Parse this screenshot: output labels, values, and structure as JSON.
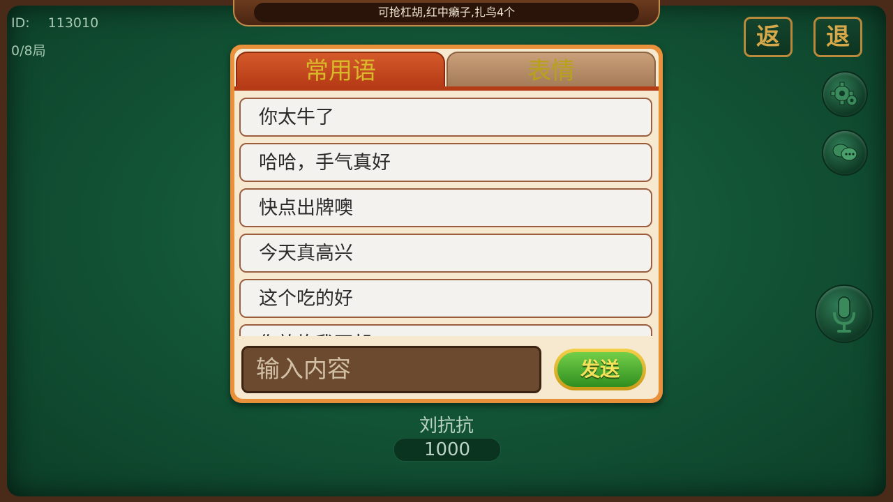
{
  "header": {
    "rules": "可抢杠胡,红中癞子,扎鸟4个"
  },
  "room": {
    "id_label": "ID:",
    "id_value": "113010",
    "round_progress": "0/8局"
  },
  "controls": {
    "back_label": "返",
    "exit_label": "退",
    "settings_icon": "gear-icon",
    "chat_icon": "chat-bubbles-icon",
    "voice_icon": "microphone-icon"
  },
  "chat": {
    "tabs": [
      {
        "label": "常用语",
        "active": true
      },
      {
        "label": "表情",
        "active": false
      }
    ],
    "phrases": [
      "你太牛了",
      "哈哈，手气真好",
      "快点出牌噢",
      "今天真高兴",
      "这个吃的好",
      "你放炮我不胡"
    ],
    "input_placeholder": "输入内容",
    "send_label": "发送"
  },
  "player": {
    "name": "刘抗抗",
    "score": "1000"
  },
  "colors": {
    "felt": "#135537",
    "panel_border": "#e8913a",
    "active_tab": "#b53a16",
    "send_button": "#2f8e1f"
  }
}
